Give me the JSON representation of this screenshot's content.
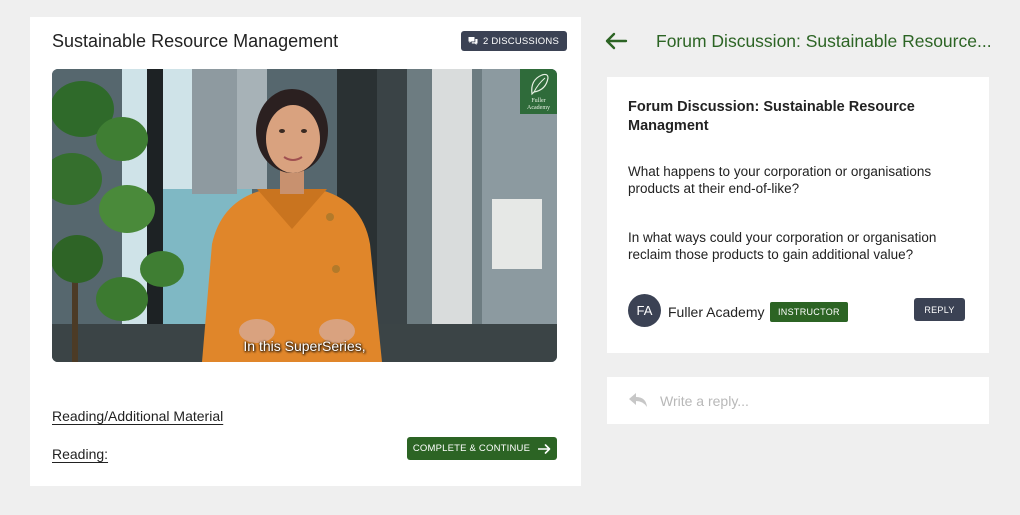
{
  "lesson": {
    "title": "Sustainable Resource Management",
    "discussions_badge": "2 DISCUSSIONS",
    "video": {
      "subtitle": "In this SuperSeries,",
      "logo_text_line1": "Fuller",
      "logo_text_line2": "Academy"
    },
    "links": {
      "reading_additional": "Reading/Additional Material",
      "reading": "Reading:"
    },
    "complete_button": "COMPLETE & CONTINUE"
  },
  "forum": {
    "header": "Forum Discussion: Sustainable Resource...",
    "post": {
      "title": "Forum Discussion: Sustainable Resource Managment",
      "question1": "What happens to your corporation or organisations products at their end-of-like?",
      "question2": "In what ways could your corporation or organisation reclaim those products to gain additional value?",
      "author_initials": "FA",
      "author_name": "Fuller Academy",
      "author_role": "INSTRUCTOR",
      "reply_button": "REPLY"
    },
    "reply_box": {
      "placeholder": "Write a reply..."
    }
  },
  "colors": {
    "brand_green": "#2c6424",
    "dark_slate": "#3b4254",
    "background": "#efefef"
  },
  "icons": [
    "chat-icon",
    "arrow-right-icon",
    "back-arrow-icon",
    "reply-icon",
    "leaf-logo-icon"
  ]
}
